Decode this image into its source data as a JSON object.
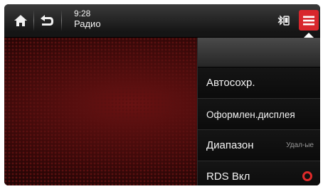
{
  "header": {
    "time": "9:28",
    "source": "Радио",
    "icons": {
      "home": "home-icon",
      "back": "back-icon",
      "bluetooth_phone": "bluetooth-phone-icon",
      "menu": "menu-icon"
    }
  },
  "menu": {
    "items": [
      {
        "label": "Автосохр."
      },
      {
        "label": "Оформлен.дисплея"
      },
      {
        "label": "Диапазон",
        "value": "Удал-ые"
      },
      {
        "label": "RDS Вкл",
        "toggle": "on"
      }
    ]
  },
  "colors": {
    "accent": "#d8262c",
    "background": "#420808",
    "text": "#f4f4f4"
  }
}
